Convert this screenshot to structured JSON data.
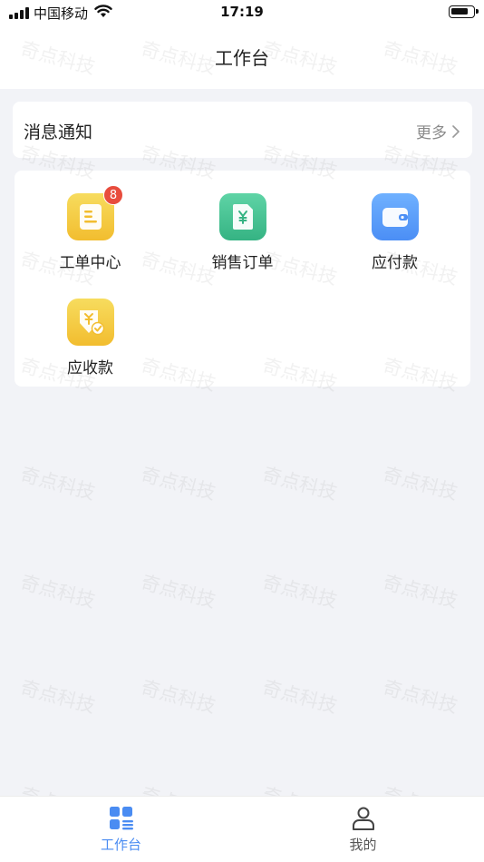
{
  "status_bar": {
    "carrier": "中国移动",
    "time": "17:19"
  },
  "header": {
    "title": "工作台"
  },
  "notice": {
    "title": "消息通知",
    "more_label": "更多"
  },
  "apps": [
    {
      "label": "工单中心",
      "icon": "document-icon",
      "color": "#f4c63f",
      "badge": "8"
    },
    {
      "label": "销售订单",
      "icon": "yuan-receipt-icon",
      "color": "#46c08f"
    },
    {
      "label": "应付款",
      "icon": "wallet-icon",
      "color": "#5a9cf8"
    },
    {
      "label": "应收款",
      "icon": "yuan-check-icon",
      "color": "#f4c63f"
    }
  ],
  "watermark": "奇点科技",
  "tabbar": {
    "items": [
      {
        "label": "工作台",
        "icon": "dashboard-grid-icon",
        "active": true
      },
      {
        "label": "我的",
        "icon": "user-icon",
        "active": false
      }
    ],
    "active_color": "#4a8cf2"
  }
}
